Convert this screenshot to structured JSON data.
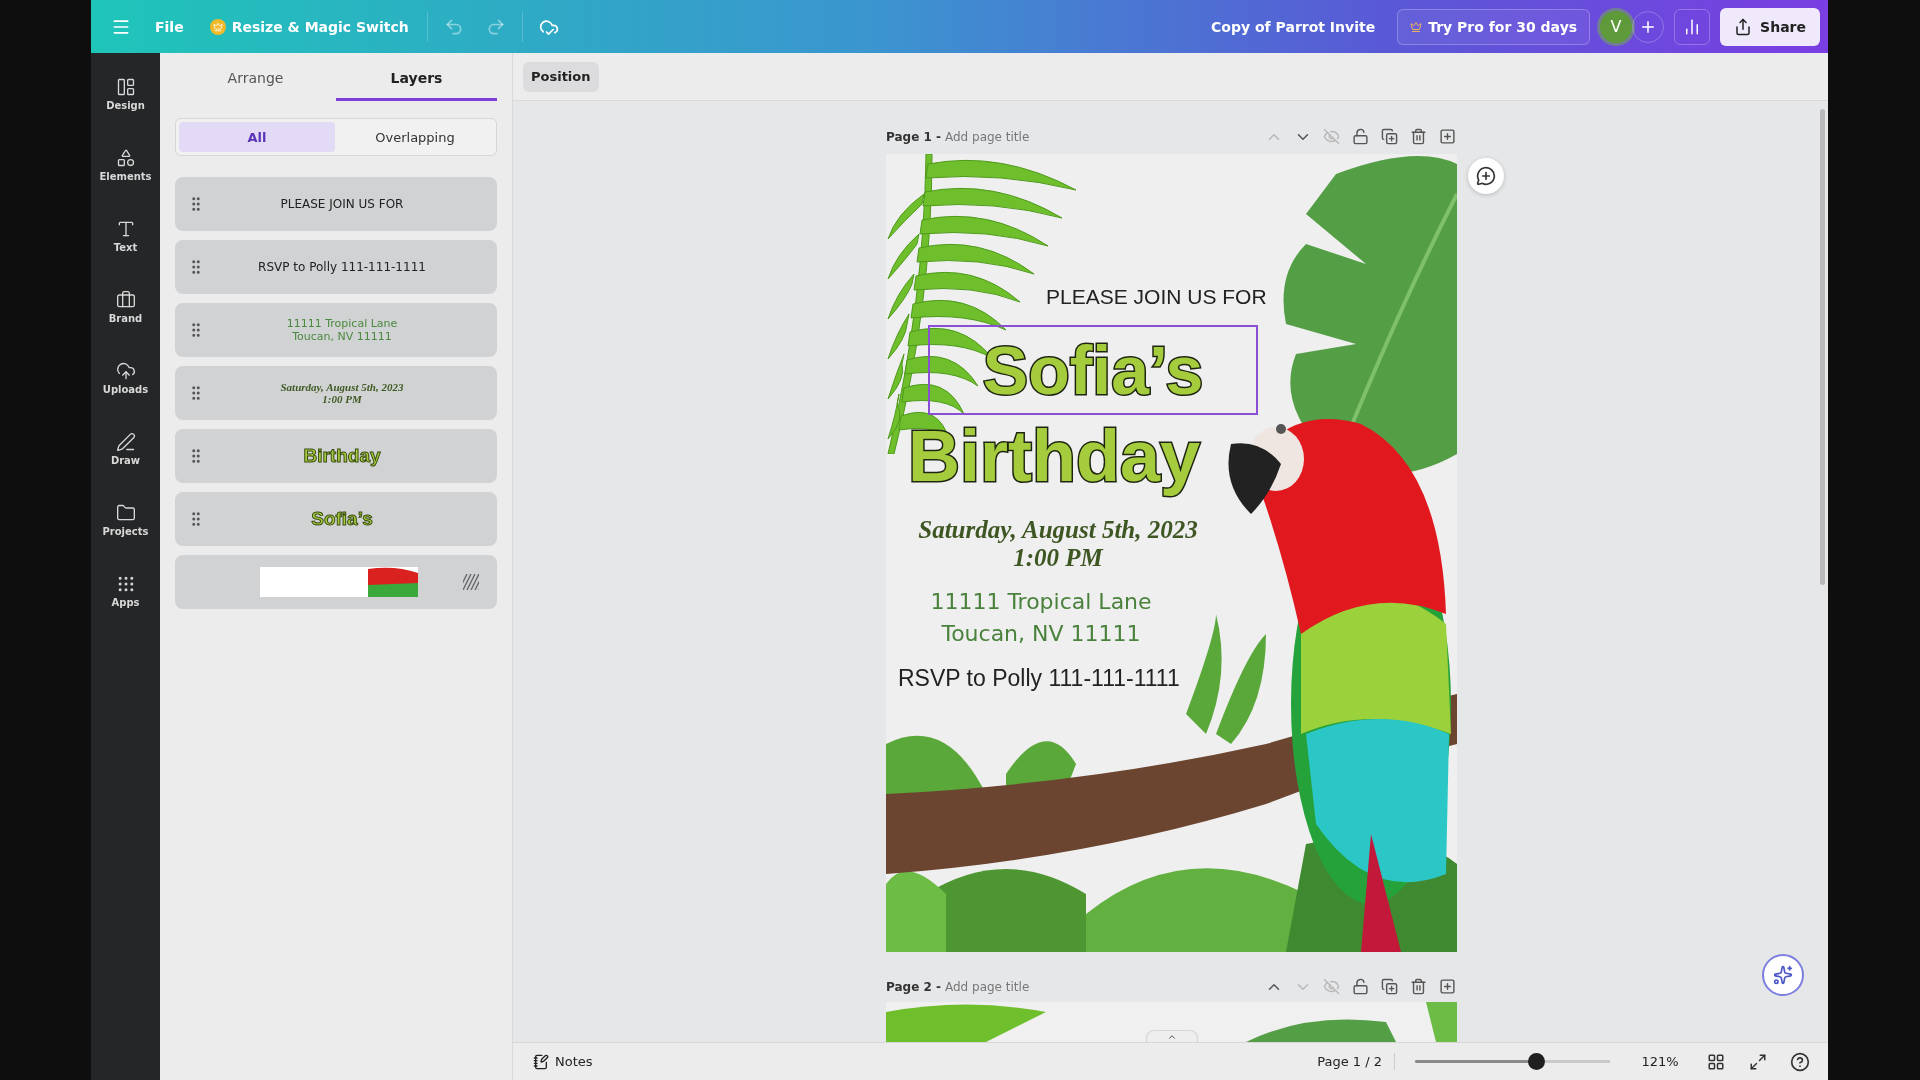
{
  "topbar": {
    "menu": "File",
    "resize": "Resize & Magic Switch",
    "doc_title": "Copy of Parrot Invite",
    "pro": "Try Pro for 30 days",
    "avatar": "V",
    "share": "Share"
  },
  "rail": [
    {
      "label": "Design"
    },
    {
      "label": "Elements"
    },
    {
      "label": "Text"
    },
    {
      "label": "Brand"
    },
    {
      "label": "Uploads"
    },
    {
      "label": "Draw"
    },
    {
      "label": "Projects"
    },
    {
      "label": "Apps"
    }
  ],
  "panel_tabs": [
    {
      "label": "Arrange",
      "selected": false
    },
    {
      "label": "Layers",
      "selected": true
    }
  ],
  "filters": [
    {
      "label": "All",
      "selected": true
    },
    {
      "label": "Overlapping",
      "selected": false
    }
  ],
  "layers": [
    {
      "kind": "plain",
      "lines": [
        "PLEASE JOIN US FOR"
      ]
    },
    {
      "kind": "plain",
      "lines": [
        "RSVP to Polly 111-111-1111"
      ]
    },
    {
      "kind": "address",
      "lines": [
        "11111 Tropical Lane",
        "Toucan, NV 11111"
      ]
    },
    {
      "kind": "date",
      "lines": [
        "Saturday, August 5th, 2023",
        "1:00 PM"
      ]
    },
    {
      "kind": "headline",
      "lines": [
        "Birthday"
      ]
    },
    {
      "kind": "headline",
      "lines": [
        "Sofia’s"
      ]
    },
    {
      "kind": "image"
    }
  ],
  "toolbar": {
    "position": "Position"
  },
  "pages": [
    {
      "label": "Page 1 -",
      "title_placeholder": "Add page title",
      "can_move_up": false,
      "can_move_down": true
    },
    {
      "label": "Page 2 -",
      "title_placeholder": "Add page title",
      "can_move_up": true,
      "can_move_down": false
    }
  ],
  "design": {
    "intro": "PLEASE JOIN US FOR",
    "name": "Sofia’s",
    "name_selected": true,
    "occasion": "Birthday",
    "date_lines": [
      "Saturday, August 5th, 2023",
      "1:00 PM"
    ],
    "address_lines": [
      "11111 Tropical Lane",
      "Toucan, NV 11111"
    ],
    "rsvp": "RSVP to Polly 111-111-1111"
  },
  "bottombar": {
    "notes": "Notes",
    "page_count": "Page 1 / 2",
    "zoom": {
      "level": 0.62,
      "reading": "121%"
    }
  }
}
